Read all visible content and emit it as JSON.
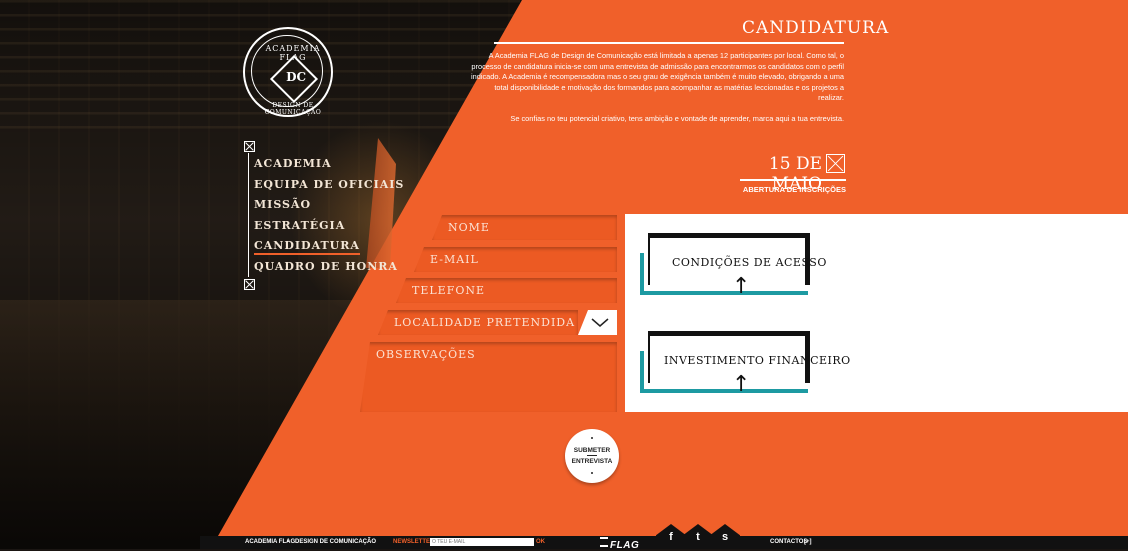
{
  "page": {
    "title": "CANDIDATURA"
  },
  "logo": {
    "top_text": "ACADEMIA FLAG",
    "monogram": "DC",
    "bottom_text": "DESIGN DE COMUNICAÇÃO"
  },
  "nav": {
    "items": [
      {
        "label": "ACADEMIA"
      },
      {
        "label": "EQUIPA DE OFICIAIS"
      },
      {
        "label": "MISSÃO"
      },
      {
        "label": "ESTRATÉGIA"
      },
      {
        "label": "CANDIDATURA",
        "active": true
      },
      {
        "label": "QUADRO DE HONRA"
      }
    ]
  },
  "intro": {
    "paragraph1": "A Academia FLAG de Design de Comunicação está limitada a apenas 12 participantes por local. Como tal, o processo de candidatura inicia-se com uma entrevista de admissão para encontrarmos os candidatos com o perfil indicado. A Academia é recompensadora mas o seu grau de exigência também é muito elevado, obrigando a uma total disponibilidade e motivação dos formandos para acompanhar as matérias leccionadas e os projetos a realizar.",
    "paragraph2": "Se confias no teu potencial criativo, tens ambição e vontade de aprender, marca aqui a tua entrevista."
  },
  "date": {
    "label": "15 DE MAIO",
    "sub": "ABERTURA DE INSCRIÇÕES",
    "icon": "close-box-icon"
  },
  "form": {
    "nome": "NOME",
    "email": "E-MAIL",
    "telefone": "TELEFONE",
    "localidade": "LOCALIDADE PRETENDIDA",
    "observacoes": "OBSERVAÇÕES"
  },
  "cards": {
    "acesso": "CONDIÇÕES DE ACESSO",
    "investimento": "INVESTIMENTO FINANCEIRO",
    "arrow": "↑"
  },
  "submit": {
    "line1": "SUBMETER",
    "line2": "ENTREVISTA"
  },
  "footer": {
    "brand1": "ACADEMIA FLAG",
    "bullet": "•",
    "brand2": "DESIGN DE COMUNICAÇÃO",
    "newsletter_label": "NEWSLETTER",
    "newsletter_placeholder": "O TEU E-MAIL",
    "ok": "OK",
    "flag": "FLAG",
    "social": [
      "f",
      "t",
      "s"
    ],
    "contactos": "CONTACTOS",
    "contactos_plus": "[+]"
  },
  "colors": {
    "orange": "#f0602a",
    "teal": "#1d9aa2",
    "dark": "#111111"
  }
}
